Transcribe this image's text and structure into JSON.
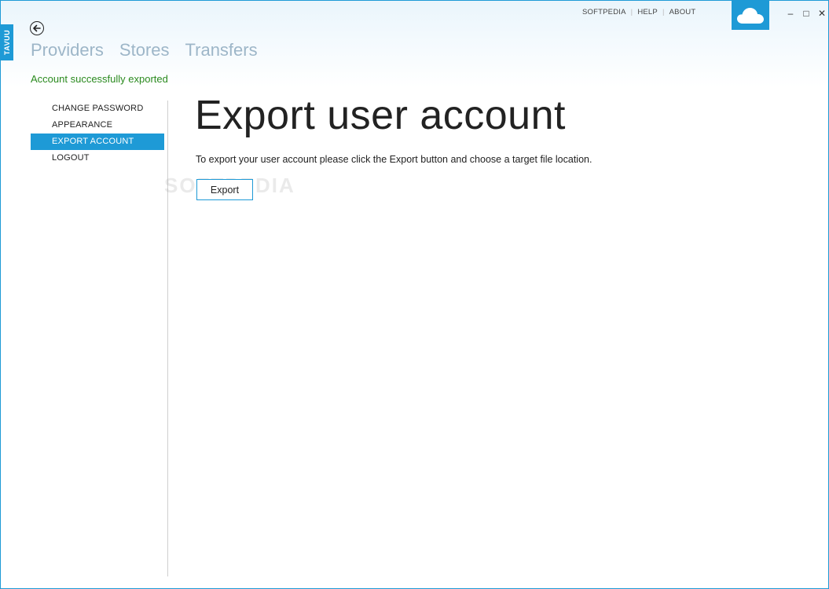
{
  "app": {
    "side_tab": "TAVUU"
  },
  "header": {
    "nav_tabs": [
      {
        "label": "Providers"
      },
      {
        "label": "Stores"
      },
      {
        "label": "Transfers"
      }
    ],
    "top_links": [
      {
        "label": "SOFTPEDIA"
      },
      {
        "label": "HELP"
      },
      {
        "label": "ABOUT"
      }
    ],
    "window_controls": {
      "minimize": "–",
      "maximize": "□",
      "close": "✕"
    }
  },
  "status": {
    "message": "Account successfully exported"
  },
  "menu": {
    "items": [
      {
        "label": "CHANGE PASSWORD",
        "active": false
      },
      {
        "label": "APPEARANCE",
        "active": false
      },
      {
        "label": "EXPORT ACCOUNT",
        "active": true
      },
      {
        "label": "LOGOUT",
        "active": false
      }
    ]
  },
  "main": {
    "title": "Export user account",
    "description": "To export your user account please click the Export button and choose a target file location.",
    "export_button": "Export",
    "watermark": "SOFTPEDIA"
  },
  "colors": {
    "accent": "#1e9ad6",
    "status_ok": "#2a8a1e",
    "nav_inactive": "#9db6c8"
  },
  "icons": {
    "back": "arrow-left-circle",
    "cloud": "cloud"
  }
}
